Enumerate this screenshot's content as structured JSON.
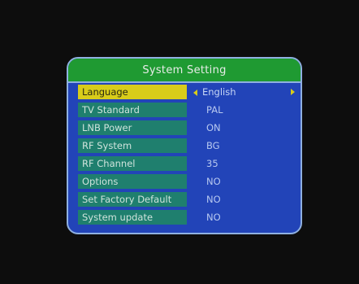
{
  "dialog": {
    "title": "System Setting"
  },
  "settings": [
    {
      "label": "Language",
      "value": "English",
      "selected": true
    },
    {
      "label": "TV Standard",
      "value": "PAL"
    },
    {
      "label": "LNB Power",
      "value": "ON"
    },
    {
      "label": "RF System",
      "value": "BG"
    },
    {
      "label": "RF Channel",
      "value": "35"
    },
    {
      "label": "Options",
      "value": "NO"
    },
    {
      "label": "Set Factory Default",
      "value": "NO"
    },
    {
      "label": "System update",
      "value": "NO"
    }
  ],
  "colors": {
    "header_green": "#1f9a32",
    "panel_blue": "#2244b8",
    "row_teal": "#1f7f6e",
    "highlight_yellow": "#d8cc1a"
  },
  "icons": {
    "left": "arrow-left-icon",
    "right": "arrow-right-icon"
  }
}
